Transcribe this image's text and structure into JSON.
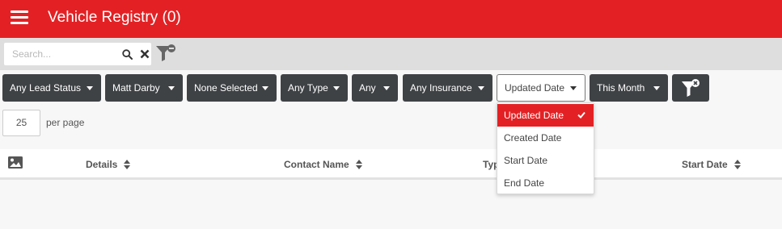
{
  "header": {
    "title": "Vehicle Registry (0)",
    "menu_icon": "hamburger-menu-icon",
    "background_color": "#e32124"
  },
  "search": {
    "placeholder": "Search...",
    "value": "",
    "search_icon": "search-icon",
    "clear_icon": "close-icon",
    "filter_icon": "filter-remove-icon"
  },
  "filters": [
    {
      "label": "Any Lead Status"
    },
    {
      "label": "Matt Darby"
    },
    {
      "label": "None Selected"
    },
    {
      "label": "Any Type"
    },
    {
      "label": "Any"
    },
    {
      "label": "Any Insurance"
    }
  ],
  "sort_field": {
    "selected": "Updated Date",
    "options": [
      "Updated Date",
      "Created Date",
      "Start Date",
      "End Date"
    ]
  },
  "date_range": {
    "label": "This Month"
  },
  "apply_filter_icon": "filter-icon",
  "pagination": {
    "per_page": "25",
    "per_page_label": "per page"
  },
  "table": {
    "image_column_icon": "image-icon",
    "columns": [
      "Details",
      "Contact Name",
      "Typ",
      "Start Date"
    ]
  },
  "colors": {
    "accent": "#e32124",
    "button_dark": "#3f4245"
  }
}
